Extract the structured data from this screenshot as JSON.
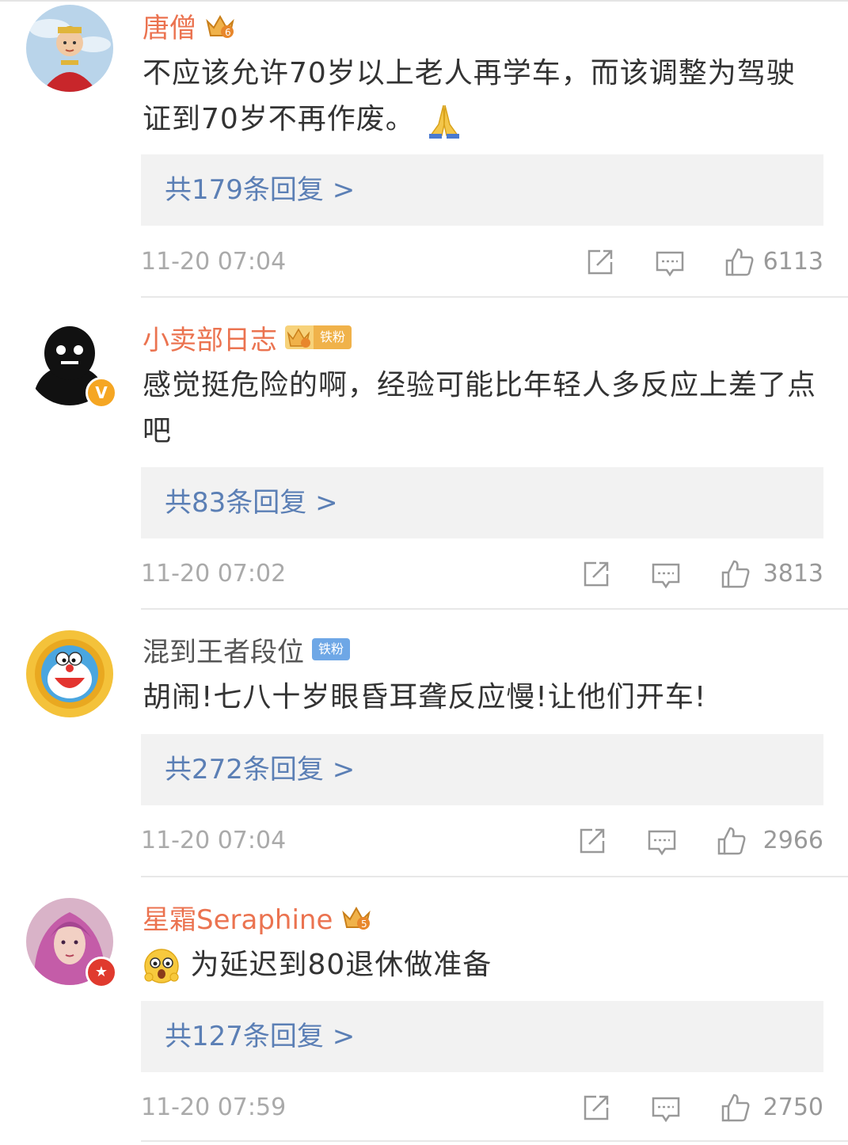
{
  "comments": [
    {
      "username": "唐僧",
      "text_parts": [
        "不应该允许70岁以上老人再学车，而该调整为驾驶证到70岁不再作废。"
      ],
      "emoji": "folded-hands",
      "replies_label": "共179条回复 >",
      "time": "11-20 07:04",
      "likes": "6113"
    },
    {
      "username": "小卖部日志",
      "fan_badge": "铁粉",
      "text_parts": [
        "感觉挺危险的啊，经验可能比年轻人多反应上差了点吧"
      ],
      "replies_label": "共83条回复 >",
      "time": "11-20 07:02",
      "likes": "3813",
      "verified_badge": "V"
    },
    {
      "username": "混到王者段位",
      "fan_badge": "铁粉",
      "text_parts": [
        "胡闹!七八十岁眼昏耳聋反应慢!让他们开车!"
      ],
      "replies_label": "共272条回复 >",
      "time": "11-20 07:04",
      "likes": "2966"
    },
    {
      "username": "星霜Seraphine",
      "text_parts": [
        "为延迟到80退休做准备"
      ],
      "emoji": "astonished-face",
      "replies_label": "共127条回复 >",
      "time": "11-20 07:59",
      "likes": "2750"
    }
  ],
  "colors": {
    "username_orange": "#eb7350",
    "reply_link_blue": "#5b7fb5",
    "reply_box_bg": "#f2f2f2",
    "meta_gray": "#aaaaaa"
  },
  "icons": [
    "share-icon",
    "comment-icon",
    "like-icon",
    "crown-badge-icon"
  ]
}
